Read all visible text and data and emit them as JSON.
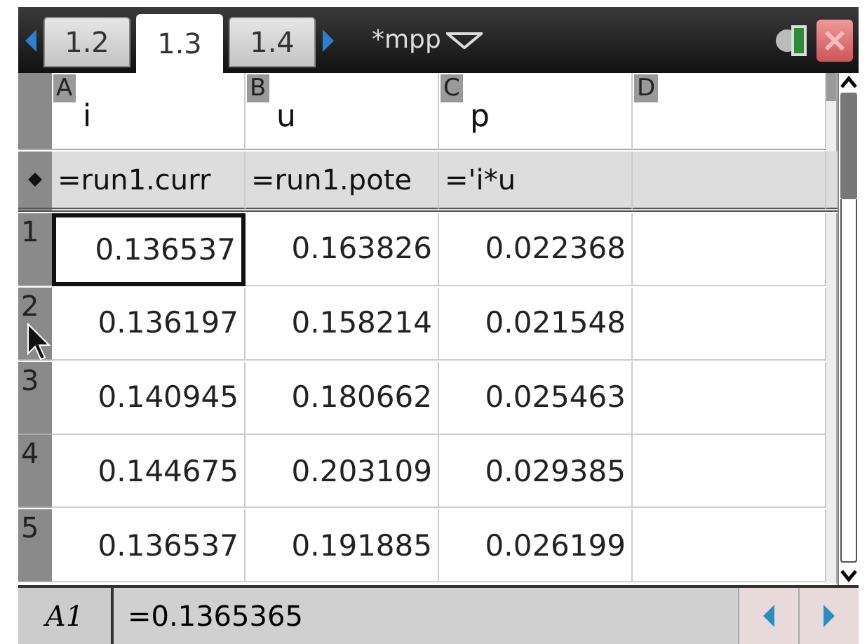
{
  "tab_bar": {
    "tabs": [
      {
        "label": "1.2",
        "selected": false
      },
      {
        "label": "1.3",
        "selected": true
      },
      {
        "label": "1.4",
        "selected": false
      }
    ],
    "document_title": "*mpp"
  },
  "columns": [
    {
      "letter": "A",
      "name": "i",
      "formula": "=run1.curr"
    },
    {
      "letter": "B",
      "name": "u",
      "formula": "=run1.pote"
    },
    {
      "letter": "C",
      "name": "p",
      "formula": "='i*u"
    },
    {
      "letter": "D"
    }
  ],
  "rows": [
    {
      "number": "1",
      "cells": [
        {
          "value": "0.136537",
          "selected": true
        },
        {
          "value": "0.163826",
          "selected": false
        },
        {
          "value": "0.022368",
          "selected": false
        },
        {
          "selected": false
        }
      ]
    },
    {
      "number": "2",
      "cells": [
        {
          "value": "0.136197",
          "selected": false
        },
        {
          "value": "0.158214",
          "selected": false
        },
        {
          "value": "0.021548",
          "selected": false
        },
        {
          "selected": false
        }
      ]
    },
    {
      "number": "3",
      "cells": [
        {
          "value": "0.140945",
          "selected": false
        },
        {
          "value": "0.180662",
          "selected": false
        },
        {
          "value": "0.025463",
          "selected": false
        },
        {
          "selected": false
        }
      ]
    },
    {
      "number": "4",
      "cells": [
        {
          "value": "0.144675",
          "selected": false
        },
        {
          "value": "0.203109",
          "selected": false
        },
        {
          "value": "0.029385",
          "selected": false
        },
        {
          "selected": false
        }
      ]
    },
    {
      "number": "5",
      "cells": [
        {
          "value": "0.136537",
          "selected": false
        },
        {
          "value": "0.191885",
          "selected": false
        },
        {
          "value": "0.026199",
          "selected": false
        },
        {
          "selected": false
        }
      ]
    }
  ],
  "entry_line": {
    "cell_reference": "A1",
    "value": "=0.1365365"
  }
}
